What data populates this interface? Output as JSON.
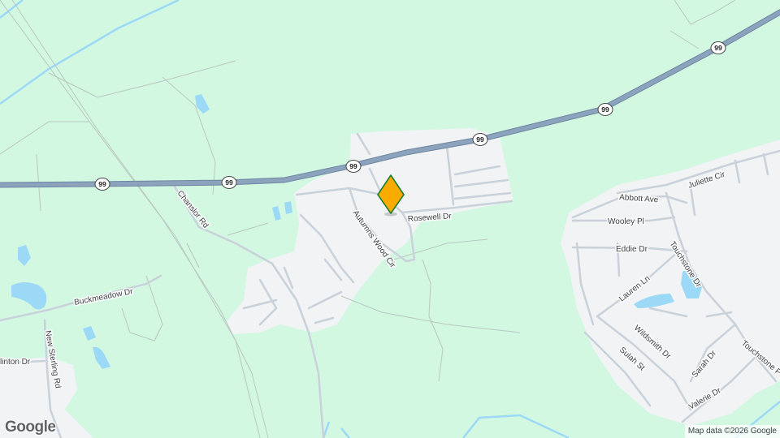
{
  "map": {
    "colors": {
      "land": "#d3f8e2",
      "developed": "#f1f3f4",
      "water": "#9cd9f7",
      "highway": "#8ba3bd",
      "highway_casing": "#6f86a0",
      "local_road": "#c9d1da",
      "marker_fill": "#f9ab00",
      "marker_stroke": "#1e7e34"
    },
    "highway_shield": "99",
    "roads": {
      "rosewell": "Rosewell Dr",
      "autumns_wood": "Autumns Wood Cir",
      "chanslor": "Chanslor Rd",
      "buckmeadow": "Buckmeadow Dr",
      "new_sterling": "New Sterling Rd",
      "clinton": "linton Dr",
      "juliette": "Juliette Cir",
      "abbott": "Abbott Ave",
      "wooley": "Wooley Pl",
      "eddie": "Eddie Dr",
      "touchstone_dr": "Touchstone Dr",
      "touchstone_p": "Touchstone P",
      "lauren": "Lauren Ln",
      "wildsmith": "Wildsmith Dr",
      "sulah": "Sulah St",
      "sarah": "Sarah Dr",
      "valerie": "Valerie Dr"
    },
    "logo": "Google",
    "attribution": "Map data ©2026 Google",
    "marker": "location-pin-icon"
  }
}
